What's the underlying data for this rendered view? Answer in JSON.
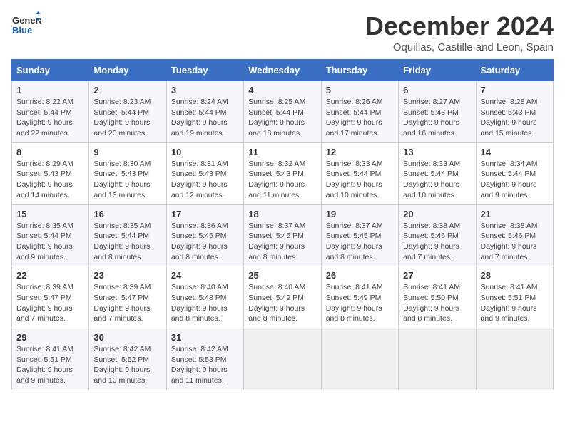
{
  "logo": {
    "line1": "General",
    "line2": "Blue"
  },
  "title": "December 2024",
  "subtitle": "Oquillas, Castille and Leon, Spain",
  "days_of_week": [
    "Sunday",
    "Monday",
    "Tuesday",
    "Wednesday",
    "Thursday",
    "Friday",
    "Saturday"
  ],
  "weeks": [
    [
      {
        "day": 1,
        "sunrise": "8:22 AM",
        "sunset": "5:44 PM",
        "daylight": "9 hours and 22 minutes."
      },
      {
        "day": 2,
        "sunrise": "8:23 AM",
        "sunset": "5:44 PM",
        "daylight": "9 hours and 20 minutes."
      },
      {
        "day": 3,
        "sunrise": "8:24 AM",
        "sunset": "5:44 PM",
        "daylight": "9 hours and 19 minutes."
      },
      {
        "day": 4,
        "sunrise": "8:25 AM",
        "sunset": "5:44 PM",
        "daylight": "9 hours and 18 minutes."
      },
      {
        "day": 5,
        "sunrise": "8:26 AM",
        "sunset": "5:44 PM",
        "daylight": "9 hours and 17 minutes."
      },
      {
        "day": 6,
        "sunrise": "8:27 AM",
        "sunset": "5:43 PM",
        "daylight": "9 hours and 16 minutes."
      },
      {
        "day": 7,
        "sunrise": "8:28 AM",
        "sunset": "5:43 PM",
        "daylight": "9 hours and 15 minutes."
      }
    ],
    [
      {
        "day": 8,
        "sunrise": "8:29 AM",
        "sunset": "5:43 PM",
        "daylight": "9 hours and 14 minutes."
      },
      {
        "day": 9,
        "sunrise": "8:30 AM",
        "sunset": "5:43 PM",
        "daylight": "9 hours and 13 minutes."
      },
      {
        "day": 10,
        "sunrise": "8:31 AM",
        "sunset": "5:43 PM",
        "daylight": "9 hours and 12 minutes."
      },
      {
        "day": 11,
        "sunrise": "8:32 AM",
        "sunset": "5:43 PM",
        "daylight": "9 hours and 11 minutes."
      },
      {
        "day": 12,
        "sunrise": "8:33 AM",
        "sunset": "5:44 PM",
        "daylight": "9 hours and 10 minutes."
      },
      {
        "day": 13,
        "sunrise": "8:33 AM",
        "sunset": "5:44 PM",
        "daylight": "9 hours and 10 minutes."
      },
      {
        "day": 14,
        "sunrise": "8:34 AM",
        "sunset": "5:44 PM",
        "daylight": "9 hours and 9 minutes."
      }
    ],
    [
      {
        "day": 15,
        "sunrise": "8:35 AM",
        "sunset": "5:44 PM",
        "daylight": "9 hours and 9 minutes."
      },
      {
        "day": 16,
        "sunrise": "8:35 AM",
        "sunset": "5:44 PM",
        "daylight": "9 hours and 8 minutes."
      },
      {
        "day": 17,
        "sunrise": "8:36 AM",
        "sunset": "5:45 PM",
        "daylight": "9 hours and 8 minutes."
      },
      {
        "day": 18,
        "sunrise": "8:37 AM",
        "sunset": "5:45 PM",
        "daylight": "9 hours and 8 minutes."
      },
      {
        "day": 19,
        "sunrise": "8:37 AM",
        "sunset": "5:45 PM",
        "daylight": "9 hours and 8 minutes."
      },
      {
        "day": 20,
        "sunrise": "8:38 AM",
        "sunset": "5:46 PM",
        "daylight": "9 hours and 7 minutes."
      },
      {
        "day": 21,
        "sunrise": "8:38 AM",
        "sunset": "5:46 PM",
        "daylight": "9 hours and 7 minutes."
      }
    ],
    [
      {
        "day": 22,
        "sunrise": "8:39 AM",
        "sunset": "5:47 PM",
        "daylight": "9 hours and 7 minutes."
      },
      {
        "day": 23,
        "sunrise": "8:39 AM",
        "sunset": "5:47 PM",
        "daylight": "9 hours and 7 minutes."
      },
      {
        "day": 24,
        "sunrise": "8:40 AM",
        "sunset": "5:48 PM",
        "daylight": "9 hours and 8 minutes."
      },
      {
        "day": 25,
        "sunrise": "8:40 AM",
        "sunset": "5:49 PM",
        "daylight": "9 hours and 8 minutes."
      },
      {
        "day": 26,
        "sunrise": "8:41 AM",
        "sunset": "5:49 PM",
        "daylight": "9 hours and 8 minutes."
      },
      {
        "day": 27,
        "sunrise": "8:41 AM",
        "sunset": "5:50 PM",
        "daylight": "9 hours and 8 minutes."
      },
      {
        "day": 28,
        "sunrise": "8:41 AM",
        "sunset": "5:51 PM",
        "daylight": "9 hours and 9 minutes."
      }
    ],
    [
      {
        "day": 29,
        "sunrise": "8:41 AM",
        "sunset": "5:51 PM",
        "daylight": "9 hours and 9 minutes."
      },
      {
        "day": 30,
        "sunrise": "8:42 AM",
        "sunset": "5:52 PM",
        "daylight": "9 hours and 10 minutes."
      },
      {
        "day": 31,
        "sunrise": "8:42 AM",
        "sunset": "5:53 PM",
        "daylight": "9 hours and 11 minutes."
      },
      null,
      null,
      null,
      null
    ]
  ]
}
